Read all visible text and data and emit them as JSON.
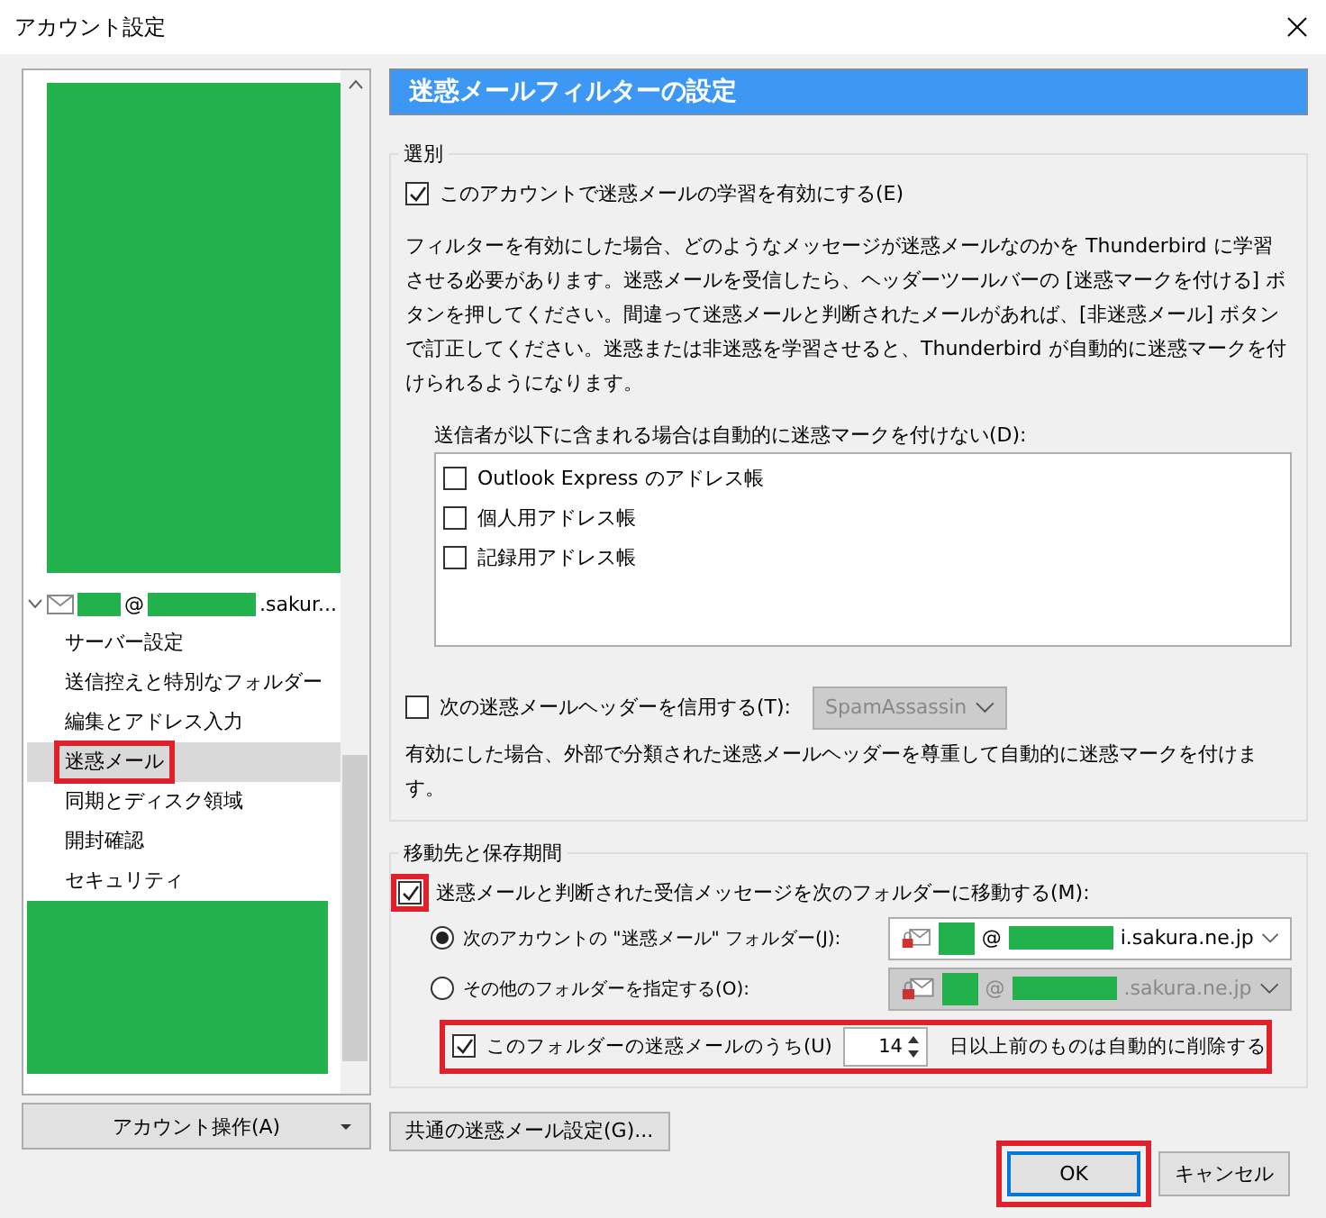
{
  "window": {
    "title": "アカウント設定"
  },
  "sidebar": {
    "account": {
      "at": "@",
      "domain": ".sakur...",
      "expanded": true,
      "children": [
        {
          "label": "サーバー設定",
          "selected": false,
          "highlighted": false
        },
        {
          "label": "送信控えと特別なフォルダー",
          "selected": false,
          "highlighted": false
        },
        {
          "label": "編集とアドレス入力",
          "selected": false,
          "highlighted": false
        },
        {
          "label": "迷惑メール",
          "selected": true,
          "highlighted": true
        },
        {
          "label": "同期とディスク領域",
          "selected": false,
          "highlighted": false
        },
        {
          "label": "開封確認",
          "selected": false,
          "highlighted": false
        },
        {
          "label": "セキュリティ",
          "selected": false,
          "highlighted": false
        }
      ]
    },
    "account_button": "アカウント操作(A)"
  },
  "panel": {
    "title": "迷惑メールフィルターの設定",
    "classification": {
      "legend": "選別",
      "learning": {
        "label": "このアカウントで迷惑メールの学習を有効にする(E)",
        "checked": true
      },
      "description": "フィルターを有効にした場合、どのようなメッセージが迷惑メールなのかを Thunderbird に学習させる必要があります。迷惑メールを受信したら、ヘッダーツールバーの [迷惑マークを付ける] ボタンを押してください。間違って迷惑メールと判断されたメールがあれば、[非迷惑メール] ボタンで訂正してください。迷惑または非迷惑を学習させると、Thunderbird が自動的に迷惑マークを付けられるようになります。",
      "whitelist_label": "送信者が以下に含まれる場合は自動的に迷惑マークを付けない(D):",
      "address_books": [
        {
          "label": "Outlook Express のアドレス帳",
          "checked": false
        },
        {
          "label": "個人用アドレス帳",
          "checked": false
        },
        {
          "label": "記録用アドレス帳",
          "checked": false
        }
      ],
      "header_trust": {
        "label": "次の迷惑メールヘッダーを信用する(T):",
        "checked": false,
        "select_value": "SpamAssassin",
        "disabled": true
      },
      "header_note": "有効にした場合、外部で分類された迷惑メールヘッダーを尊重して自動的に迷惑マークを付けます。"
    },
    "destination": {
      "legend": "移動先と保存期間",
      "move": {
        "label": "迷惑メールと判断された受信メッセージを次のフォルダーに移動する(M):",
        "checked": true,
        "highlighted": true
      },
      "options": [
        {
          "label": "次のアカウントの \"迷惑メール\" フォルダー(J):",
          "selected": true,
          "disabled": false,
          "at": "@",
          "domain": "i.sakura.ne.jp"
        },
        {
          "label": "その他のフォルダーを指定する(O):",
          "selected": false,
          "disabled": true,
          "at": "@",
          "domain": ".sakura.ne.jp"
        }
      ],
      "purge": {
        "label": "このフォルダーの迷惑メールのうち(U)",
        "checked": true,
        "value": "14",
        "suffix": "日以上前のものは自動的に削除する",
        "highlighted": true
      }
    },
    "global_button": "共通の迷惑メール設定(G)..."
  },
  "buttons": [
    {
      "label": "OK",
      "default": true,
      "highlighted": true
    },
    {
      "label": "キャンセル",
      "default": false,
      "highlighted": false
    }
  ]
}
